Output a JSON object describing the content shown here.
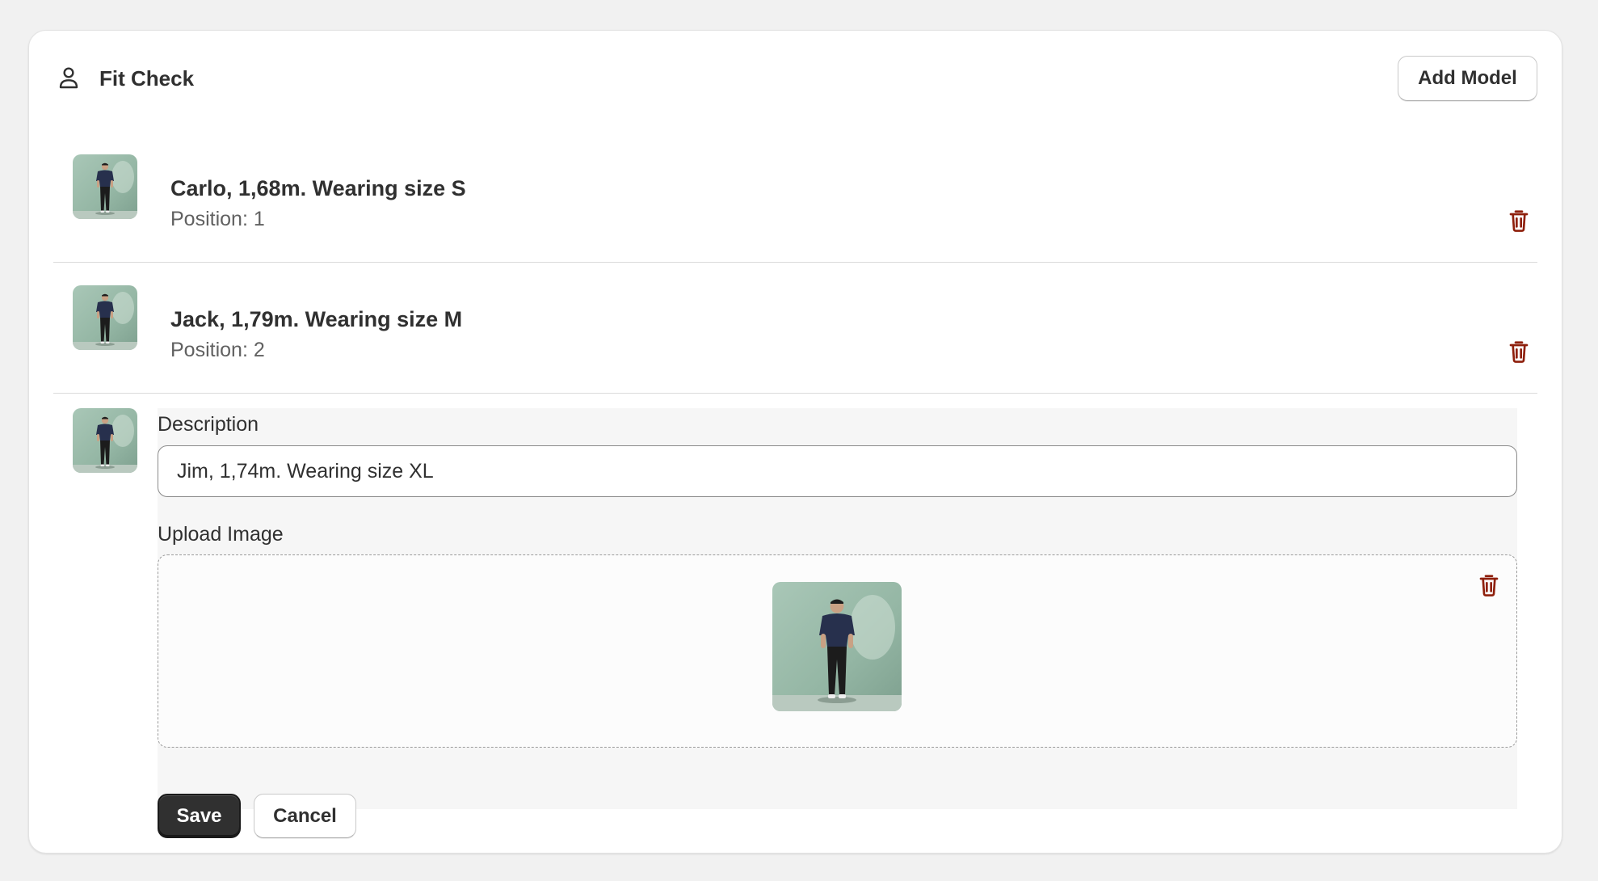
{
  "header": {
    "icon": "person-icon",
    "title": "Fit Check",
    "add_model_label": "Add Model"
  },
  "models": [
    {
      "name": "Carlo, 1,68m. Wearing size S",
      "position_label": "Position: 1"
    },
    {
      "name": "Jack, 1,79m. Wearing size M",
      "position_label": "Position: 2"
    }
  ],
  "editor": {
    "description_label": "Description",
    "description_value": "Jim, 1,74m. Wearing size XL",
    "upload_label": "Upload Image",
    "save_label": "Save",
    "cancel_label": "Cancel"
  },
  "colors": {
    "danger": "#8e1f0b",
    "primary_button": "#303030",
    "thumb_background": "#9fbfae"
  }
}
